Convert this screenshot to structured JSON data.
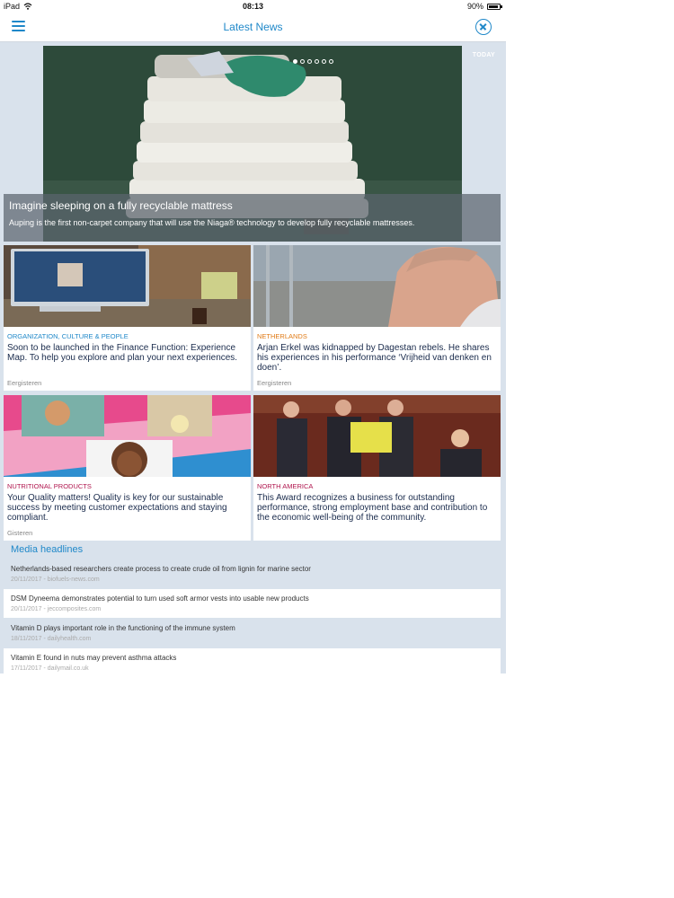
{
  "status_bar": {
    "device": "iPad",
    "time": "08:13",
    "battery": "90%"
  },
  "header": {
    "title": "Latest News",
    "menu_icon": "hamburger-icon",
    "close_icon": "close-circle-icon"
  },
  "hero": {
    "badge": "TODAY",
    "slide_count": 6,
    "active_slide": 1,
    "headline": "Imagine sleeping on a fully recyclable mattress",
    "subtitle": "Auping is the first non-carpet company that will use the Niaga® technology to develop fully recyclable mattresses."
  },
  "cards": [
    {
      "category": "ORGANIZATION, CULTURE & PEOPLE",
      "category_color": "#1f88c9",
      "text": "Soon to be launched in the Finance Function: Experience Map. To help you explore and plan your next experiences.",
      "date": "Eergisteren"
    },
    {
      "category": "NETHERLANDS",
      "category_color": "#e07b17",
      "text": "Arjan Erkel was kidnapped by Dagestan rebels. He shares his experiences in his performance ‘Vrijheid van denken en doen’.",
      "date": "Eergisteren"
    },
    {
      "category": "NUTRITIONAL PRODUCTS",
      "category_color": "#b0164e",
      "text": "Your Quality matters! Quality is key for our sustainable success by meeting customer expectations and staying compliant.",
      "date": "Gisteren"
    },
    {
      "category": "NORTH AMERICA",
      "category_color": "#b0164e",
      "text": "This Award recognizes a business for outstanding performance, strong employment base and contribution to the economic well-being of the community.",
      "date": ""
    }
  ],
  "media": {
    "title": "Media headlines",
    "items": [
      {
        "title": "Netherlands-based researchers create process to create crude oil from lignin for marine sector",
        "meta": "20/11/2017 - biofuels-news.com"
      },
      {
        "title": "DSM Dyneema demonstrates potential to turn used soft armor vests into usable new products",
        "meta": "20/11/2017 - jeccomposites.com"
      },
      {
        "title": "Vitamin D plays important role in the functioning of the immune system",
        "meta": "18/11/2017 - dailyhealth.com"
      },
      {
        "title": "Vitamin E found in nuts may prevent asthma attacks",
        "meta": "17/11/2017 - dailymail.co.uk"
      }
    ]
  }
}
